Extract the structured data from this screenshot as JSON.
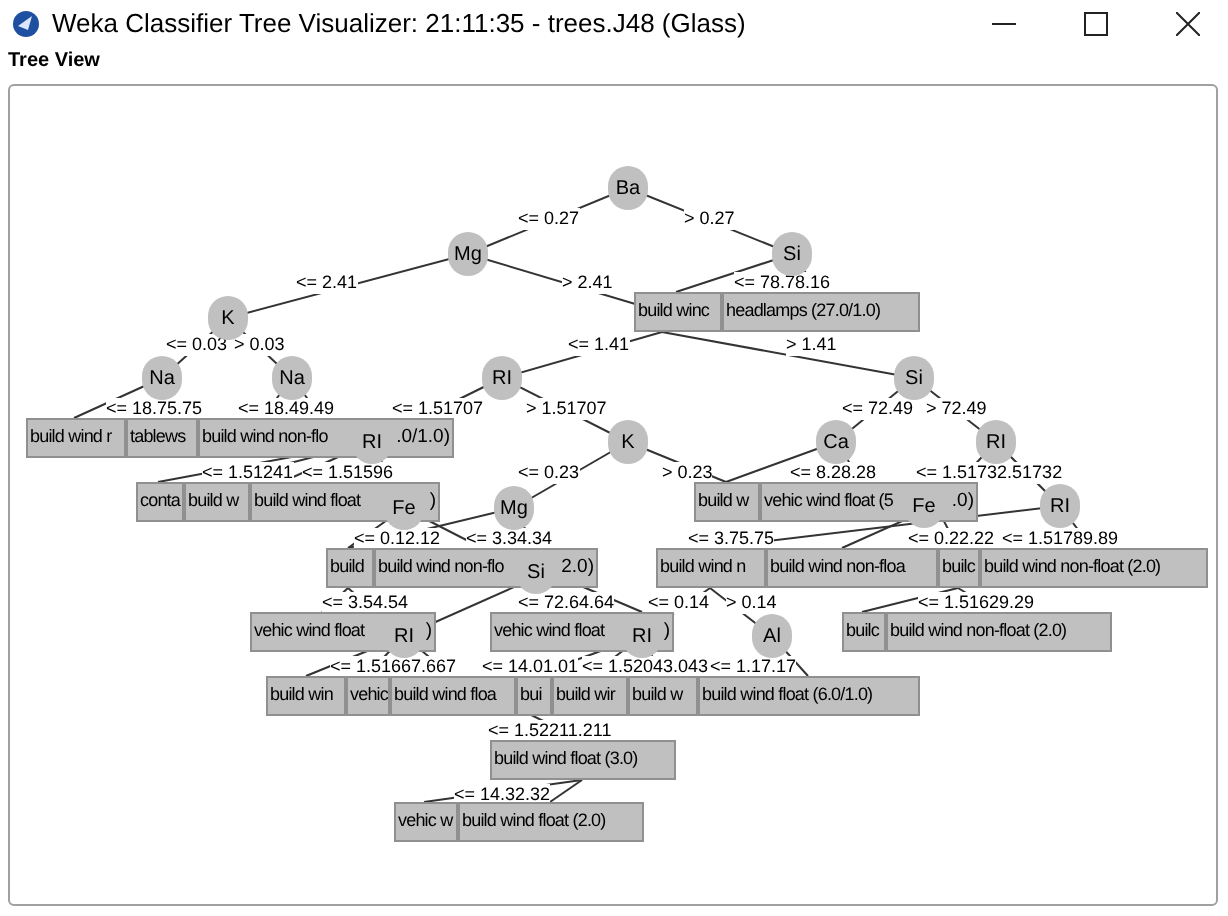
{
  "window": {
    "title": "Weka Classifier Tree Visualizer: 21:11:35 - trees.J48 (Glass)"
  },
  "panel": {
    "title": "Tree View"
  },
  "leaves": [
    {
      "text": "build wind r"
    },
    {
      "text": "tablews"
    },
    {
      "text": "build wind non-flo",
      "tail": ".0/1.0)"
    },
    {
      "text": "build winc"
    },
    {
      "text": "headlamps (27.0/1.0)"
    },
    {
      "text": "conta"
    },
    {
      "text": "build w"
    },
    {
      "text": "build wind float",
      "tail": ")"
    },
    {
      "text": "build w"
    },
    {
      "text": "vehic wind float (5",
      "tail": ".0)"
    },
    {
      "text": "build"
    },
    {
      "text": "build wind non-flo",
      "tail": "2.0)"
    },
    {
      "text": "build wind n"
    },
    {
      "text": "build wind non-floa"
    },
    {
      "text": "builc"
    },
    {
      "text": "build wind non-float (2.0)"
    },
    {
      "text": "vehic wind float",
      "tail": ")"
    },
    {
      "text": "vehic wind float",
      "tail": ")"
    },
    {
      "text": "builc"
    },
    {
      "text": "build wind non-float (2.0)"
    },
    {
      "text": "build win"
    },
    {
      "text": "vehic"
    },
    {
      "text": "build wind floa"
    },
    {
      "text": "bui"
    },
    {
      "text": "build wir"
    },
    {
      "text": "build w"
    },
    {
      "text": "build wind float (6.0/1.0)"
    },
    {
      "text": "build wind float (3.0)"
    },
    {
      "text": "vehic w"
    },
    {
      "text": "build wind float (2.0)"
    }
  ],
  "nodes": [
    {
      "label": "Ba"
    },
    {
      "label": "Mg"
    },
    {
      "label": "Si"
    },
    {
      "label": "K"
    },
    {
      "label": "Na"
    },
    {
      "label": "Na"
    },
    {
      "label": "RI"
    },
    {
      "label": "Si"
    },
    {
      "label": "RI"
    },
    {
      "label": "K"
    },
    {
      "label": "Ca"
    },
    {
      "label": "RI"
    },
    {
      "label": "Fe"
    },
    {
      "label": "Mg"
    },
    {
      "label": "Fe"
    },
    {
      "label": "RI"
    },
    {
      "label": "Si"
    },
    {
      "label": "RI"
    },
    {
      "label": "RI"
    },
    {
      "label": "Al"
    }
  ],
  "edge_labels": [
    "<= 0.27",
    "> 0.27",
    "<= 2.41",
    "> 2.41",
    "<= 78.78.16",
    "<= 0.03",
    "> 0.03",
    "<= 1.41",
    "> 1.41",
    "<= 18.75.75",
    "<= 18.49.49",
    "<= 1.51707",
    "> 1.51707",
    "<= 72.49",
    "> 72.49",
    "<= 1.51241",
    "<= 1.51596",
    "<= 0.23",
    "> 0.23",
    "<= 8.28.28",
    "<= 1.51732.51732",
    "<= 0.12.12",
    "<= 3.34.34",
    "<= 3.75.75",
    "<= 0.22.22",
    "<= 1.51789.89",
    "<= 3.54.54",
    "<= 72.64.64",
    "<= 0.14",
    "> 0.14",
    "<= 1.51629.29",
    "<= 1.51667.667",
    "<= 14.01.01",
    "<= 1.52043.043",
    "<= 1.17.17",
    "<= 1.52211.211",
    "<= 14.32.32"
  ]
}
